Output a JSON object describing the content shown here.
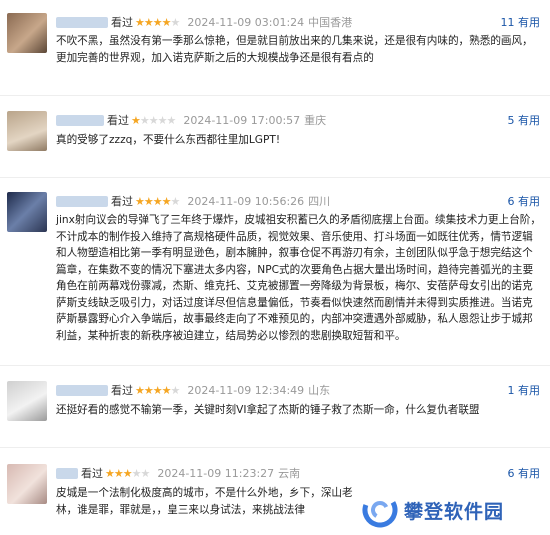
{
  "reviews": [
    {
      "status": "看过",
      "rating": 4,
      "time": "2024-11-09 03:01:24",
      "location": "中国香港",
      "useful": "11 有用",
      "content": "不吹不黑，虽然没有第一季那么惊艳，但是就目前放出来的几集来说，还是很有内味的，熟悉的画风，更加完善的世界观，加入诺克萨斯之后的大规模战争还是很有看点的"
    },
    {
      "status": "看过",
      "rating": 1,
      "time": "2024-11-09 17:00:57",
      "location": "重庆",
      "useful": "5 有用",
      "content": "真的受够了zzzq，不要什么东西都往里加LGPT!"
    },
    {
      "status": "看过",
      "rating": 4,
      "time": "2024-11-09 10:56:26",
      "location": "四川",
      "useful": "6 有用",
      "content": "jinx射向议会的导弹飞了三年终于爆炸，皮城祖安积蓄已久的矛盾彻底摆上台面。续集技术力更上台阶，不计成本的制作投入维持了高规格硬件品质，视觉效果、音乐使用、打斗场面一如既往优秀，情节逻辑和人物塑造相比第一季有明显逊色，剧本臃肿，叙事仓促不再游刃有余，主创团队似乎急于想完结这个篇章，在集数不变的情况下塞进太多内容，NPC式的次要角色占据大量出场时间，趋待完善弧光的主要角色在前两幕戏份骤减，杰斯、维克托、艾克被挪置一旁降级为背景板，梅尔、安蓓萨母女引出的诺克萨斯支线缺乏吸引力，对话过度详尽但信息量偏低，节奏看似快速然而剧情并未得到实质推进。当诺克萨斯暴露野心介入争端后，故事最终走向了不难预见的，内部冲突遭遇外部威胁，私人恩怨让步于城邦利益，某种折衷的新秩序被迫建立，结局势必以惨烈的悲剧换取短暂和平。"
    },
    {
      "status": "看过",
      "rating": 4,
      "time": "2024-11-09 12:34:49",
      "location": "山东",
      "useful": "1 有用",
      "content": "还挺好看的感觉不输第一季，关键时刻VI拿起了杰斯的锤子救了杰斯一命，什么复仇者联盟"
    },
    {
      "status": "看过",
      "rating": 3,
      "time": "2024-11-09 11:23:27",
      "location": "云南",
      "useful": "6 有用",
      "content": "皮城是一个法制化极度高的城市，不是什么外地，乡下，深山老林，谁是罪，罪就是，，皇三来以身试法，来挑战法律"
    }
  ],
  "watermark": {
    "text": "攀登软件园",
    "icon": "swirl-logo-icon"
  },
  "colors": {
    "star": "#f5a623",
    "useful": "#1b56a8",
    "meta": "#999999",
    "brand": "#2f63b8"
  }
}
